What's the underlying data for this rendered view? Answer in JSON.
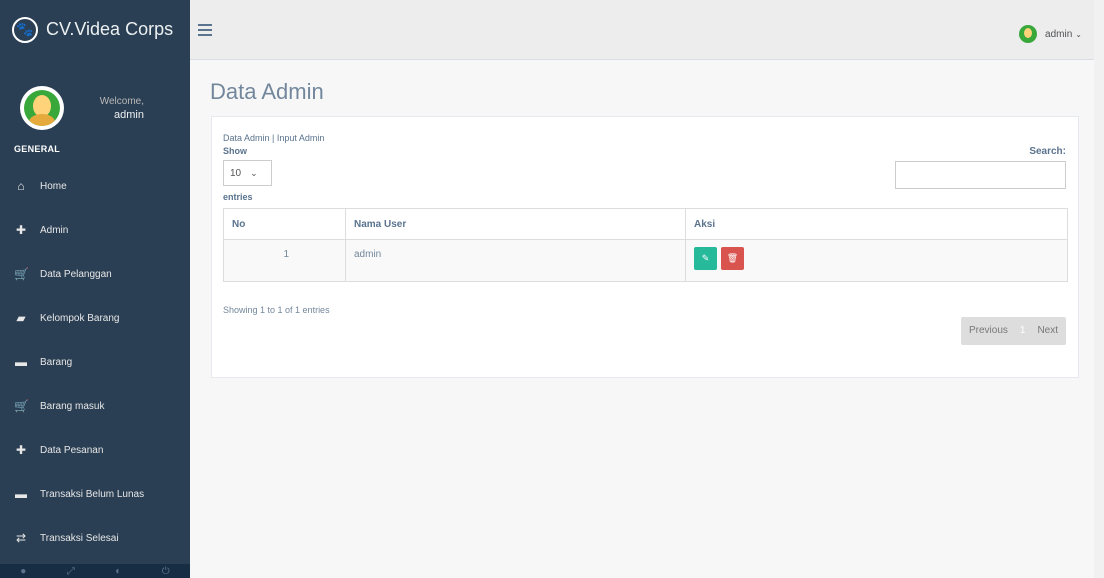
{
  "brand": {
    "title": "CV.Videa Corps",
    "logo_icon": "paw-icon"
  },
  "profile": {
    "welcome": "Welcome,",
    "name": "admin"
  },
  "sidebar": {
    "section_title": "GENERAL",
    "items": [
      {
        "label": "Home",
        "icon": "home-icon",
        "glyph": "⌂"
      },
      {
        "label": "Admin",
        "icon": "plus-icon",
        "glyph": "✚"
      },
      {
        "label": "Data Pelanggan",
        "icon": "cart-icon",
        "glyph": "🛒"
      },
      {
        "label": "Kelompok Barang",
        "icon": "bag-icon",
        "glyph": "▰"
      },
      {
        "label": "Barang",
        "icon": "laptop-icon",
        "glyph": "▬"
      },
      {
        "label": "Barang masuk",
        "icon": "cart-arrow-icon",
        "glyph": "🛒"
      },
      {
        "label": "Data Pesanan",
        "icon": "plus-icon",
        "glyph": "✚"
      },
      {
        "label": "Transaksi Belum Lunas",
        "icon": "minus-icon",
        "glyph": "▬"
      },
      {
        "label": "Transaksi Selesai",
        "icon": "retweet-icon",
        "glyph": "⇄"
      }
    ]
  },
  "topnav": {
    "user_name": "admin",
    "caret": "⌄"
  },
  "page": {
    "title": "Data Admin"
  },
  "panel": {
    "breadcrumb": "Data Admin | Input Admin",
    "show_label": "Show",
    "length_value": "10",
    "entries_label": "entries",
    "search_label": "Search:",
    "columns": [
      "No",
      "Nama User",
      "Aksi"
    ],
    "rows": [
      {
        "no": "1",
        "user": "admin"
      }
    ],
    "info": "Showing 1 to 1 of 1 entries",
    "pager": {
      "previous": "Previous",
      "current": "1",
      "next": "Next"
    }
  }
}
